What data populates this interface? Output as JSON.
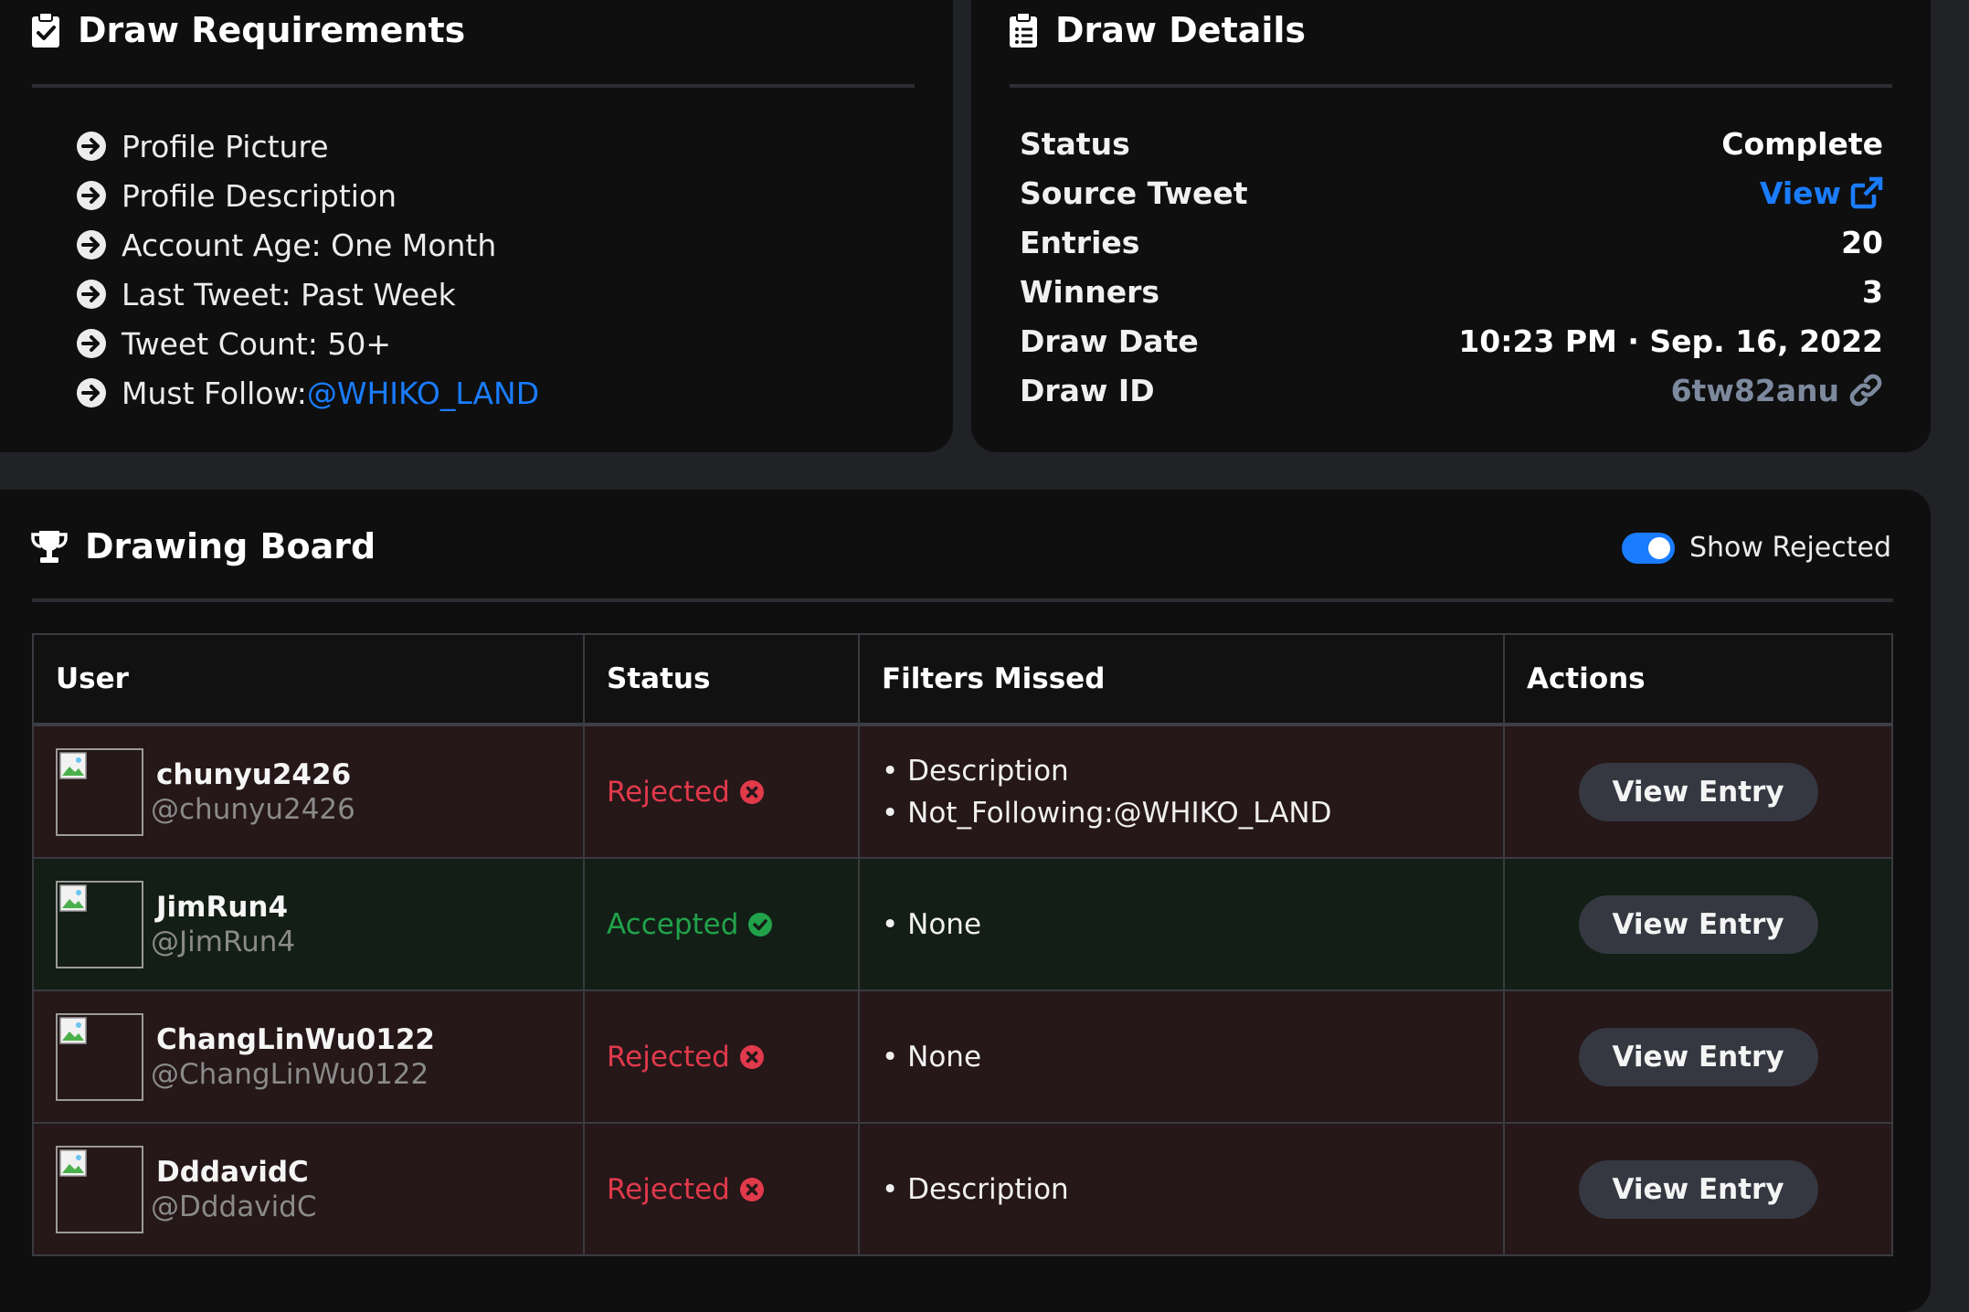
{
  "requirements": {
    "title": "Draw Requirements",
    "items": [
      {
        "label": "Profile Picture"
      },
      {
        "label": "Profile Description"
      },
      {
        "label": "Account Age: One Month"
      },
      {
        "label": "Last Tweet: Past Week"
      },
      {
        "label": "Tweet Count: 50+"
      },
      {
        "label": "Must Follow: ",
        "link": "@WHIKO_LAND"
      }
    ]
  },
  "details": {
    "title": "Draw Details",
    "rows": [
      {
        "label": "Status",
        "value": "Complete"
      },
      {
        "label": "Source Tweet",
        "value": "View"
      },
      {
        "label": "Entries",
        "value": "20"
      },
      {
        "label": "Winners",
        "value": "3"
      },
      {
        "label": "Draw Date",
        "value": "10:23 PM · Sep. 16, 2022"
      },
      {
        "label": "Draw ID",
        "value": "6tw82anu"
      }
    ]
  },
  "board": {
    "title": "Drawing Board",
    "toggle_label": "Show Rejected",
    "toggle_on": true,
    "columns": [
      "User",
      "Status",
      "Filters Missed",
      "Actions"
    ],
    "rows": [
      {
        "name": "chunyu2426",
        "handle": "@chunyu2426",
        "status": "Rejected",
        "filters": [
          "Description",
          "Not_Following:@WHIKO_LAND"
        ],
        "action": "View Entry"
      },
      {
        "name": "JimRun4",
        "handle": "@JimRun4",
        "status": "Accepted",
        "filters": [
          "None"
        ],
        "action": "View Entry"
      },
      {
        "name": "ChangLinWu0122",
        "handle": "@ChangLinWu0122",
        "status": "Rejected",
        "filters": [
          "None"
        ],
        "action": "View Entry"
      },
      {
        "name": "DddavidC",
        "handle": "@DddavidC",
        "status": "Rejected",
        "filters": [
          "Description"
        ],
        "action": "View Entry"
      }
    ]
  },
  "colors": {
    "accent": "#1a7cff",
    "rejected": "#e03a4b",
    "accepted": "#21a24a",
    "muted_link": "#7d8a9e"
  },
  "icons": {
    "requirements": "clipboard-check-icon",
    "details": "clipboard-list-icon",
    "board": "trophy-icon",
    "requirement_item": "arrow-circle-right-icon",
    "source_link": "external-link-icon",
    "draw_id_link": "link-icon",
    "rejected": "times-circle-icon",
    "accepted": "check-circle-icon",
    "avatar": "broken-image-icon"
  }
}
